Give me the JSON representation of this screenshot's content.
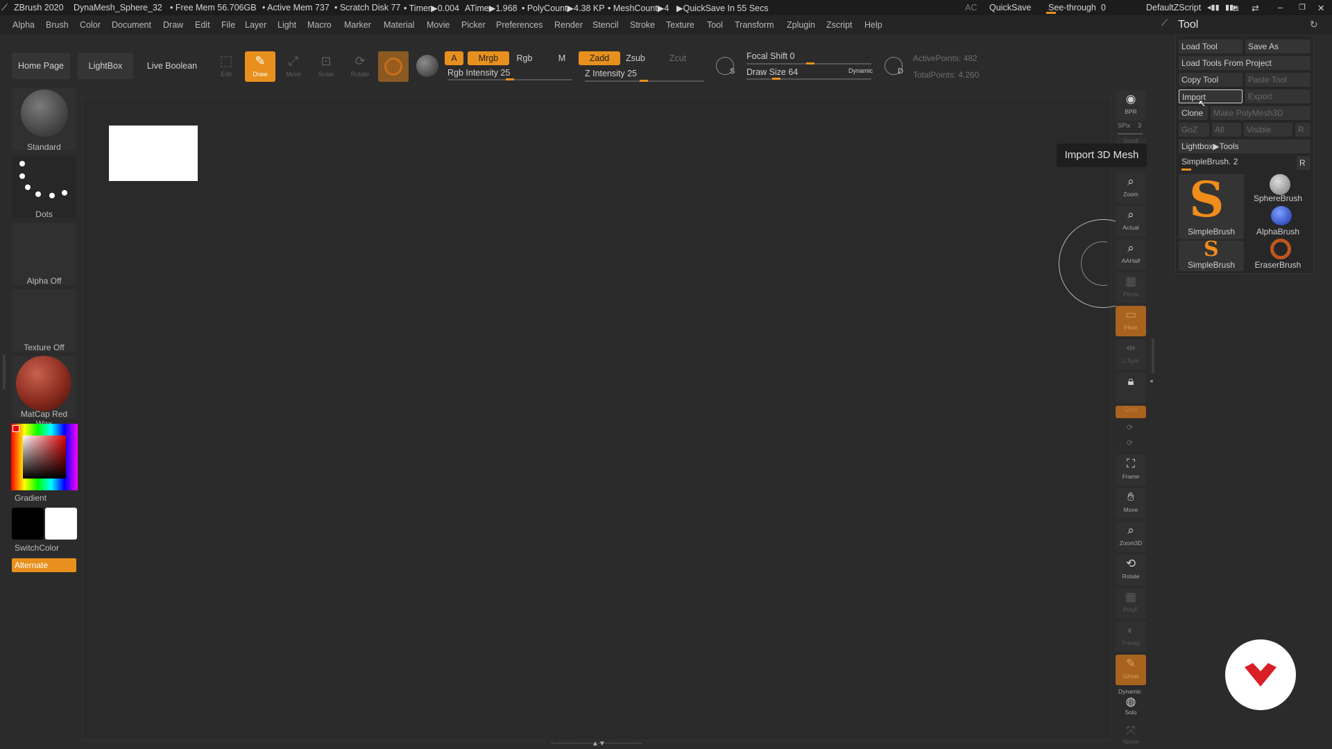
{
  "titlebar": {
    "app": "ZBrush 2020",
    "tool_name": "DynaMesh_Sphere_32",
    "free_mem": "• Free Mem 56.706GB",
    "active_mem": "• Active Mem 737",
    "scratch_disk": "• Scratch Disk 77",
    "timer": "• Timer▶0.004",
    "atime": "ATime▶1.968",
    "polycount": "• PolyCount▶4.38 KP",
    "meshcount": "• MeshCount▶4",
    "quicksave_info": "▶QuickSave In 55 Secs",
    "ac": "AC",
    "quicksave": "QuickSave",
    "see_through_label": "See-through",
    "see_through_value": "0",
    "default_zscript": "DefaultZScript"
  },
  "menu": [
    "Alpha",
    "Brush",
    "Color",
    "Document",
    "Draw",
    "Edit",
    "File",
    "Layer",
    "Light",
    "Macro",
    "Marker",
    "Material",
    "Movie",
    "Picker",
    "Preferences",
    "Render",
    "Stencil",
    "Stroke",
    "Texture",
    "Tool",
    "Transform",
    "Zplugin",
    "Zscript",
    "Help"
  ],
  "toolbar": {
    "home_page": "Home Page",
    "lightbox": "LightBox",
    "live_boolean": "Live Boolean",
    "edit": "Edit",
    "draw": "Draw",
    "move": "Move",
    "scale": "Scale",
    "rotate": "Rotate",
    "a": "A",
    "mrgb": "Mrgb",
    "rgb": "Rgb",
    "m": "M",
    "zadd": "Zadd",
    "zsub": "Zsub",
    "zcut": "Zcut",
    "rgb_intensity": "Rgb Intensity 25",
    "z_intensity": "Z Intensity 25",
    "focal_shift": "Focal Shift 0",
    "draw_size": "Draw Size 64",
    "dynamic": "Dynamic",
    "active_points": "ActivePoints: 482",
    "total_points": "TotalPoints: 4.260",
    "s_label": "S",
    "d_label": "D"
  },
  "shelf": {
    "brush": "Standard",
    "stroke": "Dots",
    "alpha": "Alpha Off",
    "texture": "Texture Off",
    "material": "MatCap Red Wax",
    "gradient": "Gradient",
    "switch_color": "SwitchColor",
    "alternate": "Alternate"
  },
  "rail": {
    "bpr": "BPR",
    "spix": "SPix",
    "spix_value": "3",
    "scroll": "Scroll",
    "zoom": "Zoom",
    "actual": "Actual",
    "aahalf": "AAHalf",
    "persp": "Persp",
    "floor": "Floor",
    "lsym": "L.Sym",
    "local": "Local",
    "qxyz": "Qxyz",
    "frame": "Frame",
    "move": "Move",
    "zoom3d": "Zoom3D",
    "rotate": "Rotate",
    "polyf": "PolyF",
    "transp": "Transp",
    "ghost": "Ghost",
    "dynamic": "Dynamic",
    "solo": "Solo",
    "xpose": "Xpose"
  },
  "tooltip": "Import 3D Mesh",
  "tool_panel": {
    "title": "Tool",
    "load_tool": "Load Tool",
    "save_as": "Save As",
    "load_from_project": "Load Tools From Project",
    "copy_tool": "Copy Tool",
    "paste_tool": "Paste Tool",
    "import": "Import",
    "export": "Export",
    "clone": "Clone",
    "make_polymesh": "Make PolyMesh3D",
    "goz": "GoZ",
    "all": "All",
    "visible": "Visible",
    "r": "R",
    "lightbox_tools": "Lightbox▶Tools",
    "current_tool": "SimpleBrush. 2",
    "r2": "R",
    "thumbs": [
      "SimpleBrush",
      "SphereBrush",
      "AlphaBrush",
      "SimpleBrush",
      "EraserBrush"
    ]
  },
  "colors": {
    "accent": "#e8901e",
    "background": "#2b2b2b",
    "logo": "#d81f26"
  }
}
